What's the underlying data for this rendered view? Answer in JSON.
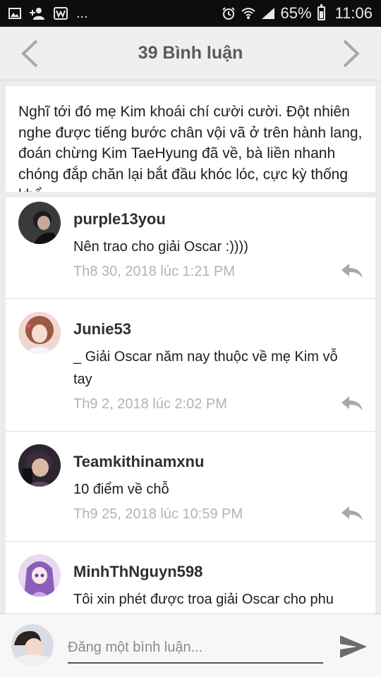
{
  "status": {
    "notification_icons": [
      "image-icon",
      "person-add-icon",
      "wattpad-w-icon",
      "more-dots"
    ],
    "more": "...",
    "battery": "65%",
    "time": "11:06"
  },
  "header": {
    "title": "39 Bình luận"
  },
  "post": {
    "excerpt": "Nghĩ tới đó mẹ Kim khoái chí cười cười. Đột nhiên nghe được tiếng bước chân vội vã ở trên hành lang, đoán chừng Kim TaeHyung đã về, bà liền nhanh chóng đắp chăn lại bắt đầu khóc lóc, cực kỳ thống khổ"
  },
  "comments": [
    {
      "user": "purple13you",
      "text": "Nên trao cho giải Oscar :))))",
      "time": "Th8 30, 2018 lúc 1:21 PM"
    },
    {
      "user": "Junie53",
      "text": "_ Giải Oscar năm nay thuộc về mẹ Kim vỗ tay",
      "time": "Th9 2, 2018 lúc 2:02 PM"
    },
    {
      "user": "Teamkithinamxnu",
      "text": "10 điểm về chỗ",
      "time": "Th9 25, 2018 lúc 10:59 PM"
    },
    {
      "user": "MinhThNguyn598",
      "text": "Tôi xin phét được troa giải Oscar cho phu",
      "time": ""
    }
  ],
  "input": {
    "placeholder": "Đăng một bình luận..."
  },
  "colors": {
    "status_bar": "#0d0d0d",
    "header_bg": "#efefef",
    "timestamp": "#b3b3b3",
    "icon_gray": "#a8a8a8"
  }
}
